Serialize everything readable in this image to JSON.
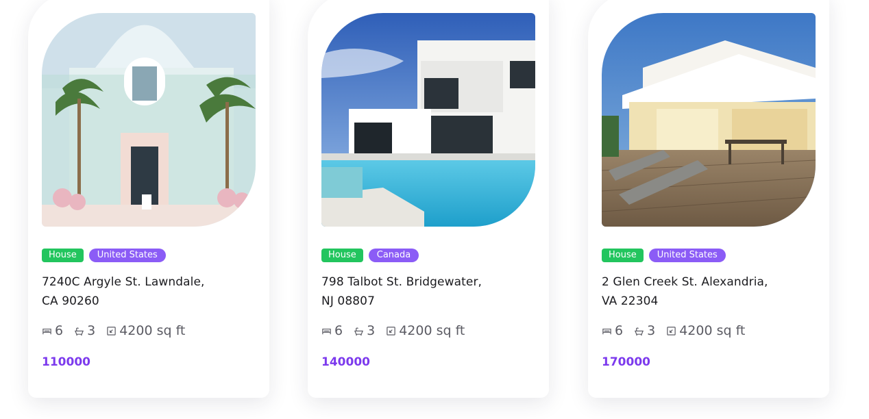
{
  "listings": [
    {
      "image": "white-pastel-house-with-palm-trees",
      "type_tag": "House",
      "country_tag": "United States",
      "address_line1": "7240C Argyle St. Lawndale,",
      "address_line2": "CA 90260",
      "beds": "6",
      "baths": "3",
      "area": "4200 sq ft",
      "price": "110000"
    },
    {
      "image": "modern-villa-with-pool",
      "type_tag": "House",
      "country_tag": "Canada",
      "address_line1": "798 Talbot St. Bridgewater,",
      "address_line2": "NJ 08807",
      "beds": "6",
      "baths": "3",
      "area": "4200 sq ft",
      "price": "140000"
    },
    {
      "image": "house-with-wooden-deck-at-dusk",
      "type_tag": "House",
      "country_tag": "United States",
      "address_line1": "2 Glen Creek St. Alexandria,",
      "address_line2": "VA 22304",
      "beds": "6",
      "baths": "3",
      "area": "4200 sq ft",
      "price": "170000"
    }
  ],
  "icons": {
    "beds": "bed-icon",
    "baths": "bathtub-icon",
    "area": "area-icon"
  },
  "colors": {
    "type_tag": "#22c55e",
    "country_tag": "#8b5cf6",
    "price": "#7c3aed"
  }
}
